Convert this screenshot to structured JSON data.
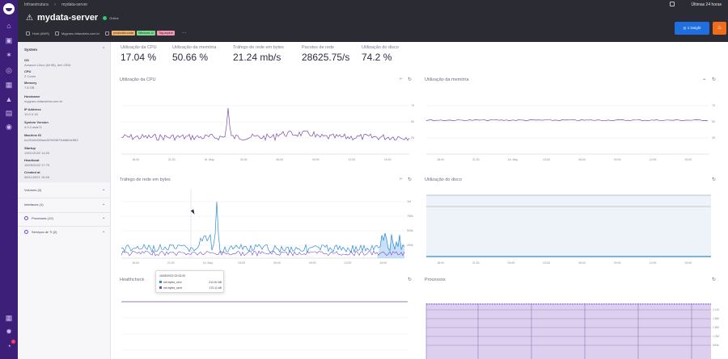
{
  "header": {
    "breadcrumbs": [
      "Infraestrutura",
      "mydata-server"
    ],
    "period": "Últimas 24 horas",
    "title": "mydata-server",
    "status": "Online",
    "meta": [
      "Host (AWS)",
      "Mygranu.bitacoleta.com.br"
    ],
    "tags": [
      "production.node",
      "Windows 10",
      "Tag-aspirar"
    ],
    "insight_button": "1 insight"
  },
  "panel": {
    "section_title": "System",
    "fields": [
      {
        "label": "OS",
        "value": "Amazon Linux (kit 96), dev 2015"
      },
      {
        "label": "CPU",
        "value": "2 Cores"
      },
      {
        "label": "Memory",
        "value": "7.8 GB"
      },
      {
        "label": "Hostname",
        "value": "mygranu.bitacoleta.com.br"
      },
      {
        "label": "IP Address",
        "value": "10.0.0.18"
      },
      {
        "label": "System Version",
        "value": "4.0.2-aws71"
      },
      {
        "label": "Machine ID",
        "value": "ec2f1b0d9f4aa457bf06f73dd8b0e963"
      },
      {
        "label": "Startup",
        "value": "19/01/2022 14:20"
      },
      {
        "label": "Heartbeat",
        "value": "16/05/2022 17:79"
      },
      {
        "label": "Created at",
        "value": "08/11/2021 10:48"
      }
    ],
    "accordions": [
      "Volumes (0)",
      "Interfaces (1)",
      "Processes (12)",
      "Serviços de TI (2)"
    ]
  },
  "metrics": [
    {
      "label": "Utilização da CPU",
      "value": "17.04 %"
    },
    {
      "label": "Utilização da memória",
      "value": "50.66 %"
    },
    {
      "label": "Tráfego de rede em bytes",
      "value": "21.24 mb/s"
    },
    {
      "label": "Pacotes de rede",
      "value": "28625.75/s"
    },
    {
      "label": "Utilização do disco",
      "value": "74.2 %"
    }
  ],
  "charts": {
    "cpu": {
      "title": "Utilização da CPU",
      "xticks": [
        "18:00",
        "21:00",
        "16. May",
        "03:00",
        "06:00",
        "09:00",
        "12:00",
        "15:00"
      ],
      "yticks": [
        "75",
        "50",
        "25"
      ]
    },
    "mem": {
      "title": "Utilização da memória",
      "xticks": [
        "18:00",
        "21:00",
        "16. May",
        "03:00",
        "06:00",
        "09:00",
        "12:00",
        "15:00"
      ],
      "yticks": [
        "75",
        "50",
        "25"
      ]
    },
    "net": {
      "title": "Tráfego de rede em bytes",
      "xticks": [
        "18:00",
        "21:00",
        "16. May",
        "03:00",
        "06:00",
        "09:00",
        "12:00",
        "15:00"
      ],
      "yticks": [
        "1M",
        "750k",
        "500k",
        "250k"
      ]
    },
    "disk": {
      "title": "Utilização do disco",
      "xticks": [
        "18:00",
        "21:00",
        "00:00",
        "03:00",
        "06:00",
        "09:00",
        "12:00",
        "15:00"
      ]
    },
    "health": {
      "title": "Healthcheck"
    },
    "proc": {
      "title": "Processos",
      "yticks": [
        "2.1M",
        "1.8M",
        "1.5M",
        "1.2M",
        "900k"
      ]
    }
  },
  "tooltip": {
    "time": "16/05/2022 02:02:00",
    "rows": [
      {
        "name": "net.bytes_recv",
        "value": "212.61 kB",
        "color": "#2b8cd6"
      },
      {
        "name": "net.bytes_sent",
        "value": "170.11 kB",
        "color": "#6f4cd6"
      }
    ]
  },
  "colors": {
    "accent": "#3d1f7a",
    "cpu_line": "#7b4aa8",
    "net_recv": "#2b8cd6",
    "net_sent": "#6f4cd6",
    "online": "#2ecc71",
    "insight": "#1f6fe0",
    "alert": "#ef6c1a"
  }
}
